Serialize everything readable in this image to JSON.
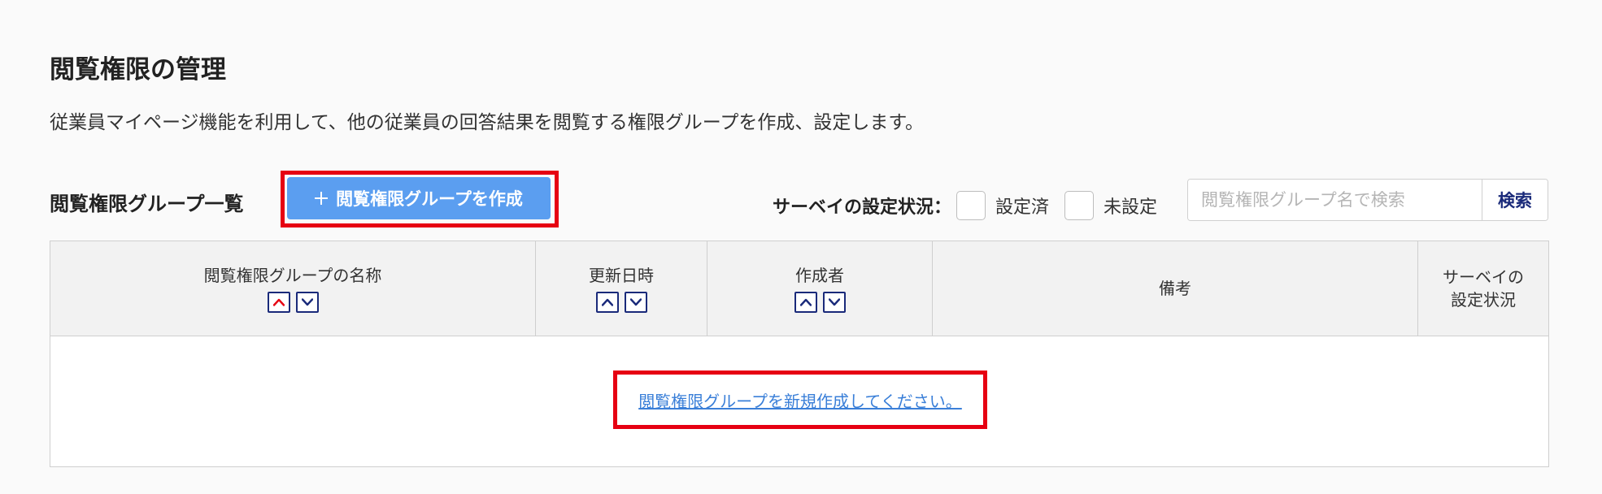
{
  "page": {
    "title": "閲覧権限の管理",
    "description": "従業員マイページ機能を利用して、他の従業員の回答結果を閲覧する権限グループを作成、設定します。"
  },
  "list": {
    "title": "閲覧権限グループ一覧",
    "create_button_label": "閲覧権限グループを作成"
  },
  "filter": {
    "label": "サーベイの設定状況：",
    "options": [
      "設定済",
      "未設定"
    ]
  },
  "search": {
    "placeholder": "閲覧権限グループ名で検索",
    "button_label": "検索"
  },
  "table": {
    "columns": {
      "name": "閲覧権限グループの名称",
      "updated": "更新日時",
      "creator": "作成者",
      "notes": "備考",
      "status_line1": "サーベイの",
      "status_line2": "設定状況"
    },
    "empty_message": "閲覧権限グループを新規作成してください。"
  },
  "colors": {
    "primary_button": "#5b9ef0",
    "highlight": "#e60012",
    "link": "#3a7fd8",
    "sort_border": "#1a2a7a",
    "sort_active": "#e60012"
  },
  "icons": {
    "create": "plus-icon",
    "sort_asc": "chevron-up-icon",
    "sort_desc": "chevron-down-icon"
  }
}
